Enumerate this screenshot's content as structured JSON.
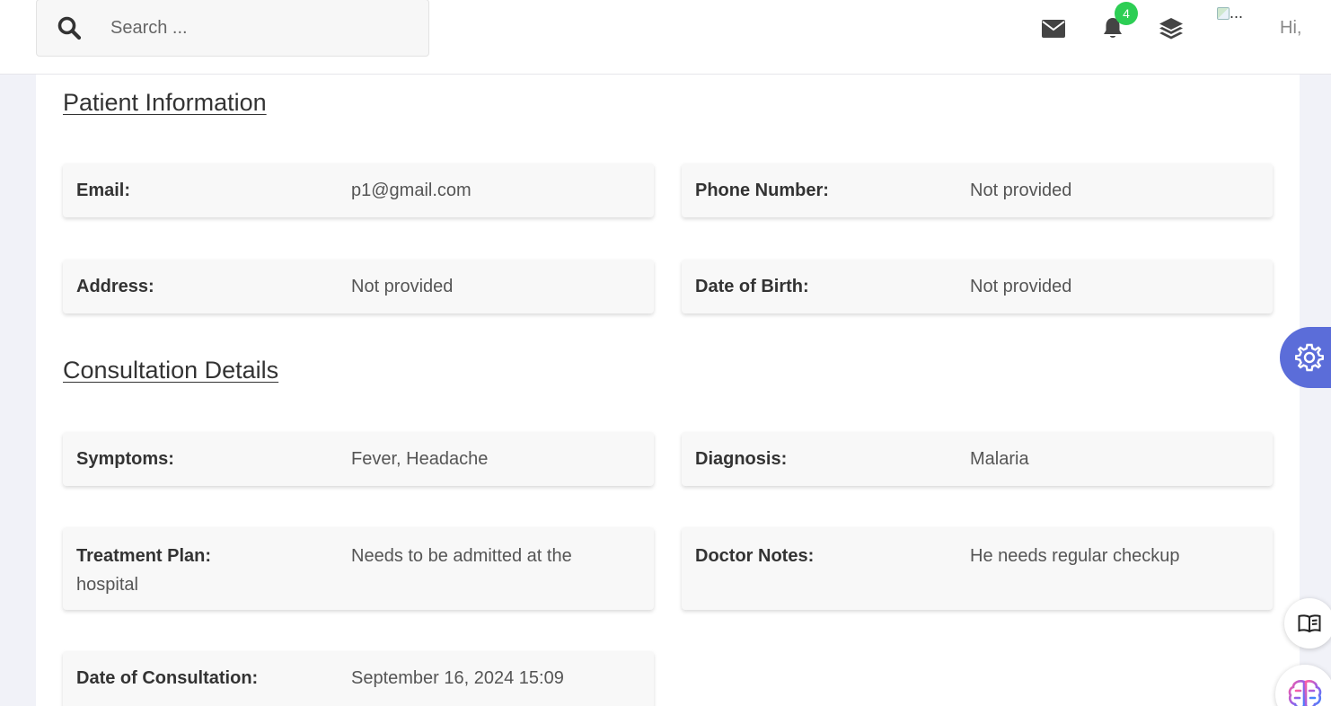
{
  "header": {
    "search_placeholder": "Search ...",
    "notification_count": "4",
    "avatar_alt": "...",
    "greeting": "Hi,"
  },
  "patient_info": {
    "title": "Patient Information",
    "email": {
      "label": "Email:",
      "value": "p1@gmail.com"
    },
    "phone": {
      "label": "Phone Number:",
      "value": "Not provided"
    },
    "address": {
      "label": "Address:",
      "value": "Not provided"
    },
    "dob": {
      "label": "Date of Birth:",
      "value": "Not provided"
    }
  },
  "consultation": {
    "title": "Consultation Details",
    "symptoms": {
      "label": "Symptoms:",
      "value": "Fever, Headache"
    },
    "diagnosis": {
      "label": "Diagnosis:",
      "value": "Malaria"
    },
    "treatment": {
      "label": "Treatment Plan:",
      "value": "Needs to be admitted at the hospital"
    },
    "notes": {
      "label": "Doctor Notes:",
      "value": "He needs regular checkup"
    },
    "date": {
      "label": "Date of Consultation:",
      "value": "September 16, 2024 15:09"
    }
  },
  "icons": {
    "search": "search-icon",
    "mail": "envelope-icon",
    "bell": "bell-icon",
    "layers": "layers-icon",
    "settings": "gear-icon",
    "docs": "book-icon",
    "assistant": "brain-icon"
  },
  "colors": {
    "accent": "#5b6dd9",
    "badge": "#2dce54"
  }
}
